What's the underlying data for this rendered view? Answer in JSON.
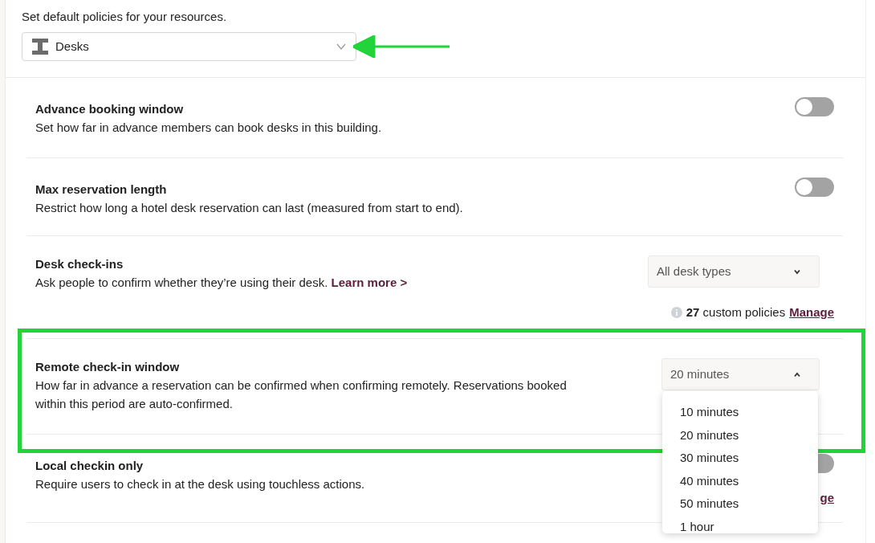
{
  "intro": "Set default policies for your resources.",
  "resource_select": {
    "value": "Desks",
    "expanded": false
  },
  "policies": [
    {
      "kind": "toggle",
      "title": "Advance booking window",
      "description": "Set how far in advance members can book desks in this building.",
      "on": false
    },
    {
      "kind": "toggle",
      "title": "Max reservation length",
      "description": "Restrict how long a hotel desk reservation can last (measured from start to end).",
      "on": false
    },
    {
      "kind": "select",
      "title": "Desk check-ins",
      "description": "Ask people to confirm whether they’re using their desk.",
      "link": "Learn more >",
      "select": {
        "value": "All desk types",
        "expanded": false
      },
      "custom_policies": "**27** custom policies",
      "manage_link": "Manage"
    },
    {
      "kind": "select",
      "title": "Remote check-in window",
      "description": "How far in advance a reservation can be confirmed when confirming remotely. Reservations booked within this period are auto-confirmed.",
      "select": {
        "value": "20 minutes",
        "expanded": true,
        "options": [
          "10 minutes",
          "20 minutes",
          "30 minutes",
          "40 minutes",
          "50 minutes",
          "1 hour"
        ]
      }
    },
    {
      "kind": "toggle",
      "title": "Local checkin only",
      "description": "Require users to check in at the desk using touchless actions.",
      "on": false,
      "manage_link": "ge"
    }
  ]
}
